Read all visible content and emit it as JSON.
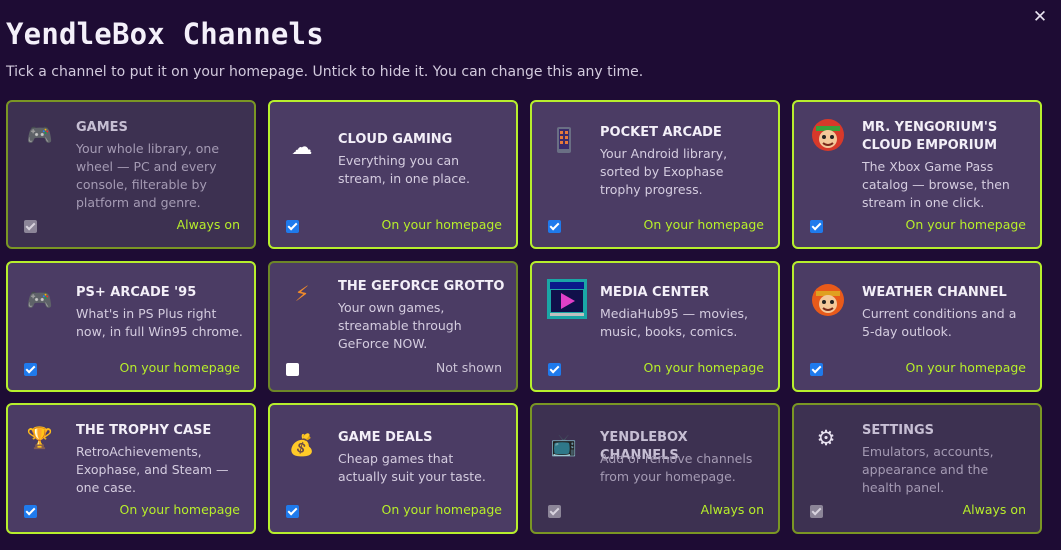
{
  "header": {
    "title": "YendleBox Channels",
    "subtitle": "Tick a channel to put it on your homepage. Untick to hide it. You can change this any time.",
    "close_glyph": "✕"
  },
  "colors": {
    "background": "#1e0c34",
    "card": "#4b3c64",
    "border_on": "#b7ef2d",
    "status_on": "#b8ef2a",
    "checkbox_checked": "#1f7aec"
  },
  "channels": [
    {
      "title": "GAMES",
      "desc": "Your whole library, one wheel — PC and every console, filterable by platform and genre.",
      "status": "Always on",
      "checked": true,
      "locked": true,
      "icon": "gamepad-icon",
      "glyph": "🎮"
    },
    {
      "title": "CLOUD GAMING",
      "desc": "Everything you can stream, in one place.",
      "status": "On your homepage",
      "checked": true,
      "locked": false,
      "icon": "cloud-icon",
      "glyph": "☁"
    },
    {
      "title": "POCKET ARCADE",
      "desc": "Your Android library, sorted by Exophase trophy progress.",
      "status": "On your homepage",
      "checked": true,
      "locked": false,
      "icon": "handheld-device-icon",
      "glyph": ""
    },
    {
      "title": "MR. YENGORIUM'S CLOUD EMPORIUM",
      "desc": "The Xbox Game Pass catalog — browse, then stream in one click.",
      "status": "On your homepage",
      "checked": true,
      "locked": false,
      "icon": "character-avatar-icon",
      "glyph": ""
    },
    {
      "title": "PS+ ARCADE '95",
      "desc": "What's in PS Plus right now, in full Win95 chrome.",
      "status": "On your homepage",
      "checked": true,
      "locked": false,
      "icon": "gamepad-icon",
      "glyph": "🎮"
    },
    {
      "title": "THE GEFORCE GROTTO",
      "desc": "Your own games, streamable through GeForce NOW.",
      "status": "Not shown",
      "checked": false,
      "locked": false,
      "icon": "lightning-icon",
      "glyph": "⚡"
    },
    {
      "title": "MEDIA CENTER",
      "desc": "MediaHub95 — movies, music, books, comics.",
      "status": "On your homepage",
      "checked": true,
      "locked": false,
      "icon": "media-player-icon",
      "glyph": ""
    },
    {
      "title": "WEATHER CHANNEL",
      "desc": "Current conditions and a 5-day outlook.",
      "status": "On your homepage",
      "checked": true,
      "locked": false,
      "icon": "weather-character-icon",
      "glyph": ""
    },
    {
      "title": "THE TROPHY CASE",
      "desc": "RetroAchievements, Exophase, and Steam — one case.",
      "status": "On your homepage",
      "checked": true,
      "locked": false,
      "icon": "trophy-icon",
      "glyph": "🏆"
    },
    {
      "title": "GAME DEALS",
      "desc": "Cheap games that actually suit your taste.",
      "status": "On your homepage",
      "checked": true,
      "locked": false,
      "icon": "money-bag-icon",
      "glyph": "💰"
    },
    {
      "title": "YENDLEBOX CHANNELS",
      "desc": "Add or remove channels from your homepage.",
      "status": "Always on",
      "checked": true,
      "locked": true,
      "icon": "tv-icon",
      "glyph": "📺"
    },
    {
      "title": "SETTINGS",
      "desc": "Emulators, accounts, appearance and the health panel.",
      "status": "Always on",
      "checked": true,
      "locked": true,
      "icon": "gear-icon",
      "glyph": "⚙"
    }
  ]
}
